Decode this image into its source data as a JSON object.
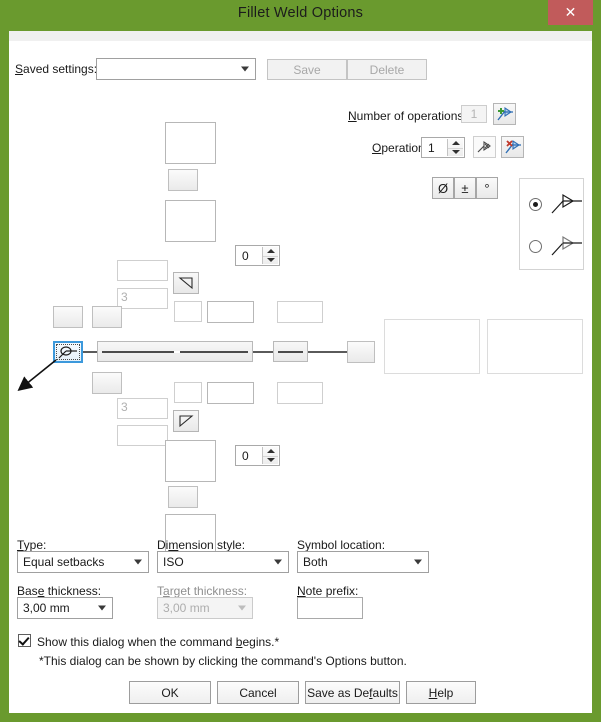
{
  "window": {
    "title": "Fillet Weld Options",
    "close_label": "✕",
    "accent_green": "#6a9a2e",
    "close_red": "#c15b5b"
  },
  "saved_settings": {
    "label": "Saved settings:",
    "value": "",
    "placeholder": "",
    "save_label": "Save",
    "delete_label": "Delete"
  },
  "operations": {
    "number_label": "Number of operations:",
    "number_value": "1",
    "add_icon": "add-operation-icon",
    "operation_label": "Operation:",
    "operation_value": "1",
    "pick_icon": "pick-operation-icon",
    "remove_icon": "remove-operation-icon"
  },
  "symbol_toolbar": {
    "diameter_label": "Ø",
    "plusminus_label": "±",
    "degree_label": "°"
  },
  "arrow_side": {
    "option1_icon": "weld-arrow-filled-icon",
    "option2_icon": "weld-arrow-hollow-icon",
    "selected": 0
  },
  "diagram": {
    "top_spin_value": "0",
    "bottom_spin_value": "0",
    "top_size_placeholder": "3",
    "bottom_size_placeholder": "3",
    "leader_button_icon": "weld-leader-arrow-icon",
    "top_triangle_icon": "fillet-triangle-left-icon",
    "bottom_triangle_icon": "fillet-triangle-right-icon"
  },
  "fields": {
    "type_label": "Type:",
    "type_value": "Equal setbacks",
    "dimension_style_label": "Dimension style:",
    "dimension_style_value": "ISO",
    "symbol_location_label": "Symbol location:",
    "symbol_location_value": "Both",
    "base_thickness_label": "Base thickness:",
    "base_thickness_value": "3,00 mm",
    "target_thickness_label": "Target thickness:",
    "target_thickness_value": "3,00 mm",
    "note_prefix_label": "Note prefix:",
    "note_prefix_value": ""
  },
  "show_dialog": {
    "checked": true,
    "label": "Show this dialog when the command begins.*",
    "footnote": "*This dialog can be shown by clicking the command's Options button."
  },
  "buttons": {
    "ok": "OK",
    "cancel": "Cancel",
    "save_defaults": "Save as Defaults",
    "help": "Help"
  }
}
